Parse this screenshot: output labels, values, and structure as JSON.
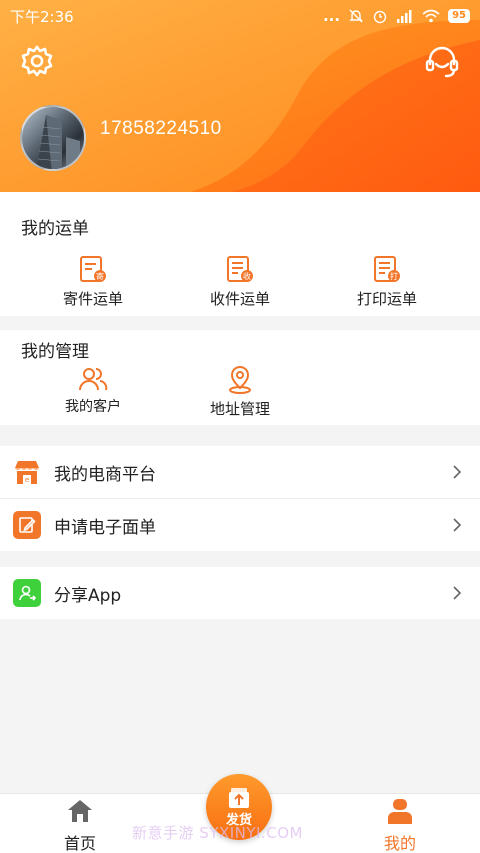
{
  "status_bar": {
    "time": "下午2:36",
    "battery": "95",
    "signal_dots": "..."
  },
  "header": {
    "phone": "17858224510",
    "settings_icon": "gear-icon",
    "service_icon": "headset-icon"
  },
  "waybills": {
    "title": "我的运单",
    "items": [
      {
        "label": "寄件运单",
        "icon": "send-waybill-icon"
      },
      {
        "label": "收件运单",
        "icon": "receive-waybill-icon"
      },
      {
        "label": "打印运单",
        "icon": "print-waybill-icon"
      }
    ]
  },
  "management": {
    "title": "我的管理",
    "items": [
      {
        "label": "我的客户",
        "icon": "customers-icon"
      },
      {
        "label": "地址管理",
        "icon": "location-pin-icon"
      }
    ]
  },
  "menu": [
    {
      "label": "我的电商平台",
      "icon": "shop-icon",
      "color": "#f2762a"
    },
    {
      "label": "申请电子面单",
      "icon": "edit-form-icon",
      "color": "#f2762a"
    },
    {
      "label": "分享App",
      "icon": "share-user-icon",
      "color": "#3ed13b"
    }
  ],
  "tabbar": {
    "home": "首页",
    "ship": "发货",
    "mine": "我的"
  },
  "watermark": "新意手游 SYXINYI.COM",
  "colors": {
    "accent": "#f2762a",
    "header_start": "#ff9d3a",
    "header_end": "#ff6d14",
    "green": "#3ed13b"
  }
}
